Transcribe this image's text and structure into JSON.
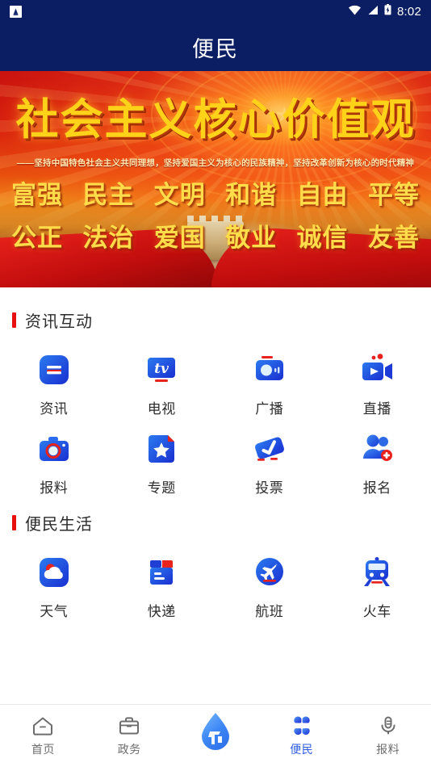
{
  "statusbar": {
    "app_notification_icon": "app-notification-icon",
    "wifi_icon": "wifi-icon",
    "signal_icon": "cell-signal-icon",
    "battery_icon": "battery-charging-icon",
    "time": "8:02"
  },
  "appbar": {
    "title": "便民",
    "bg_color": "#0b1d63"
  },
  "banner": {
    "title": "社会主义核心价值观",
    "subtitle": "——坚持中国特色社会主义共同理想，坚持爱国主义为核心的民族精神，坚持改革创新为核心的时代精神",
    "values_row1": [
      "富强",
      "民主",
      "文明",
      "和谐",
      "自由",
      "平等"
    ],
    "values_row2": [
      "公正",
      "法治",
      "爱国",
      "敬业",
      "诚信",
      "友善"
    ],
    "accent_color": "#ffdc4a"
  },
  "sections": [
    {
      "title": "资讯互动",
      "bar_color": "#e8100f",
      "items": [
        {
          "label": "资讯",
          "icon": "news-icon"
        },
        {
          "label": "电视",
          "icon": "tv-icon"
        },
        {
          "label": "广播",
          "icon": "radio-icon"
        },
        {
          "label": "直播",
          "icon": "live-video-icon"
        },
        {
          "label": "报料",
          "icon": "camera-icon"
        },
        {
          "label": "专题",
          "icon": "topic-star-icon"
        },
        {
          "label": "投票",
          "icon": "vote-check-icon"
        },
        {
          "label": "报名",
          "icon": "signup-people-icon"
        }
      ]
    },
    {
      "title": "便民生活",
      "bar_color": "#e8100f",
      "items": [
        {
          "label": "天气",
          "icon": "weather-cloud-icon"
        },
        {
          "label": "快递",
          "icon": "express-box-icon"
        },
        {
          "label": "航班",
          "icon": "flight-plane-icon"
        },
        {
          "label": "火车",
          "icon": "train-icon"
        }
      ]
    }
  ],
  "tabbar": {
    "active_color": "#2f5fe0",
    "inactive_color": "#6d6d6d",
    "items": [
      {
        "label": "首页",
        "icon": "home-icon",
        "active": false
      },
      {
        "label": "政务",
        "icon": "briefcase-icon",
        "active": false
      },
      {
        "label": "",
        "icon": "water-drop-fab-icon",
        "active": false
      },
      {
        "label": "便民",
        "icon": "clover-icon",
        "active": true
      },
      {
        "label": "报料",
        "icon": "microphone-icon",
        "active": false
      }
    ]
  }
}
